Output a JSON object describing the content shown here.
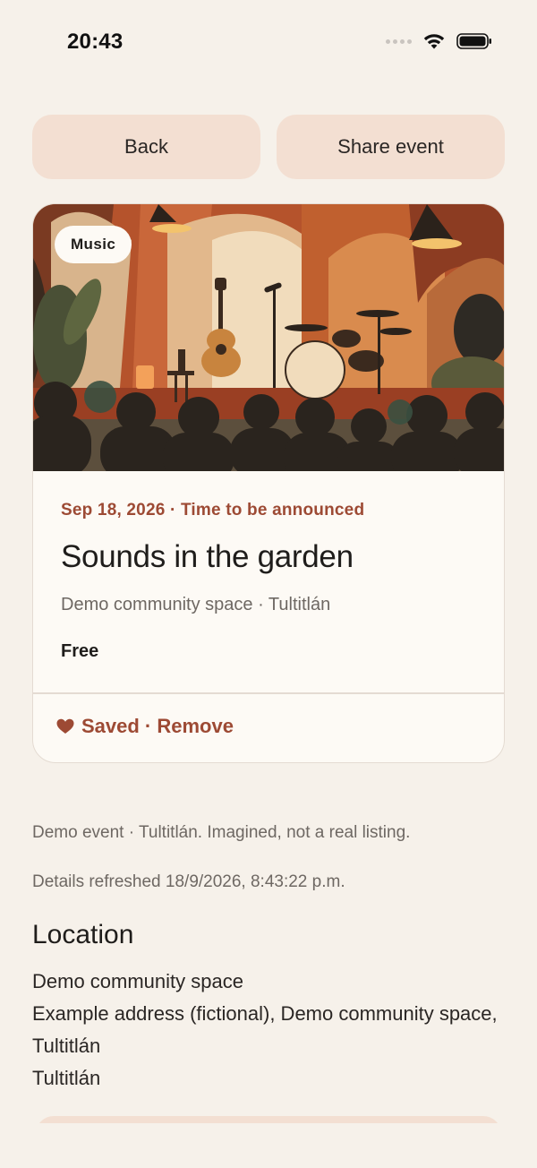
{
  "status_bar": {
    "time": "20:43"
  },
  "top_actions": {
    "back_label": "Back",
    "share_label": "Share event"
  },
  "event": {
    "category": "Music",
    "datetime": "Sep 18, 2026 · Time to be announced",
    "title": "Sounds in the garden",
    "venue": "Demo community space · Tultitlán",
    "price": "Free",
    "saved_label": "Saved · Remove"
  },
  "meta": {
    "disclaimer": "Demo event · Tultitlán. Imagined, not a real listing.",
    "refreshed": "Details refreshed 18/9/2026, 8:43:22 p.m."
  },
  "location": {
    "heading": "Location",
    "lines": [
      "Demo community space",
      "Example address (fictional), Demo community space, Tultitlán",
      "Tultitlán"
    ]
  },
  "colors": {
    "background": "#f6f1ea",
    "button_fill": "#f3dfd2",
    "accent": "#9d4a34",
    "card_fill": "#fdfaf5"
  }
}
